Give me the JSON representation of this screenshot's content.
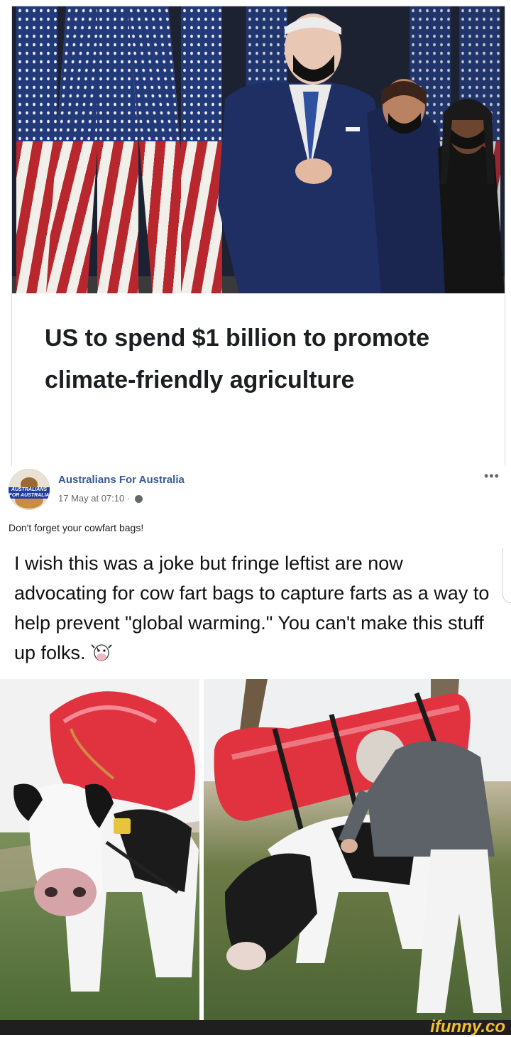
{
  "article": {
    "headline": "US to spend $1 billion to promote climate-friendly agriculture"
  },
  "post": {
    "page_name": "Australians For Australia",
    "timestamp": "17 May at 07:10 ·",
    "text": "Don't forget your cowfart bags!",
    "more_label": "•••",
    "avatar_text": "AUSTRALIANS FOR AUSTRALIA"
  },
  "quote": {
    "text": "I wish this was a joke but fringe leftist are now advocating for cow fart bags to capture farts as a way to help prevent \"global warming.\" You can't make this stuff up folks."
  },
  "footer": {
    "watermark": "ifunny.co"
  },
  "colors": {
    "link": "#385898",
    "meta": "#65676b",
    "watermark": "#f6c02c",
    "fart_bag": "#e0333f"
  },
  "icons": [
    "globe-icon",
    "more-options-icon",
    "cow-face-icon"
  ]
}
